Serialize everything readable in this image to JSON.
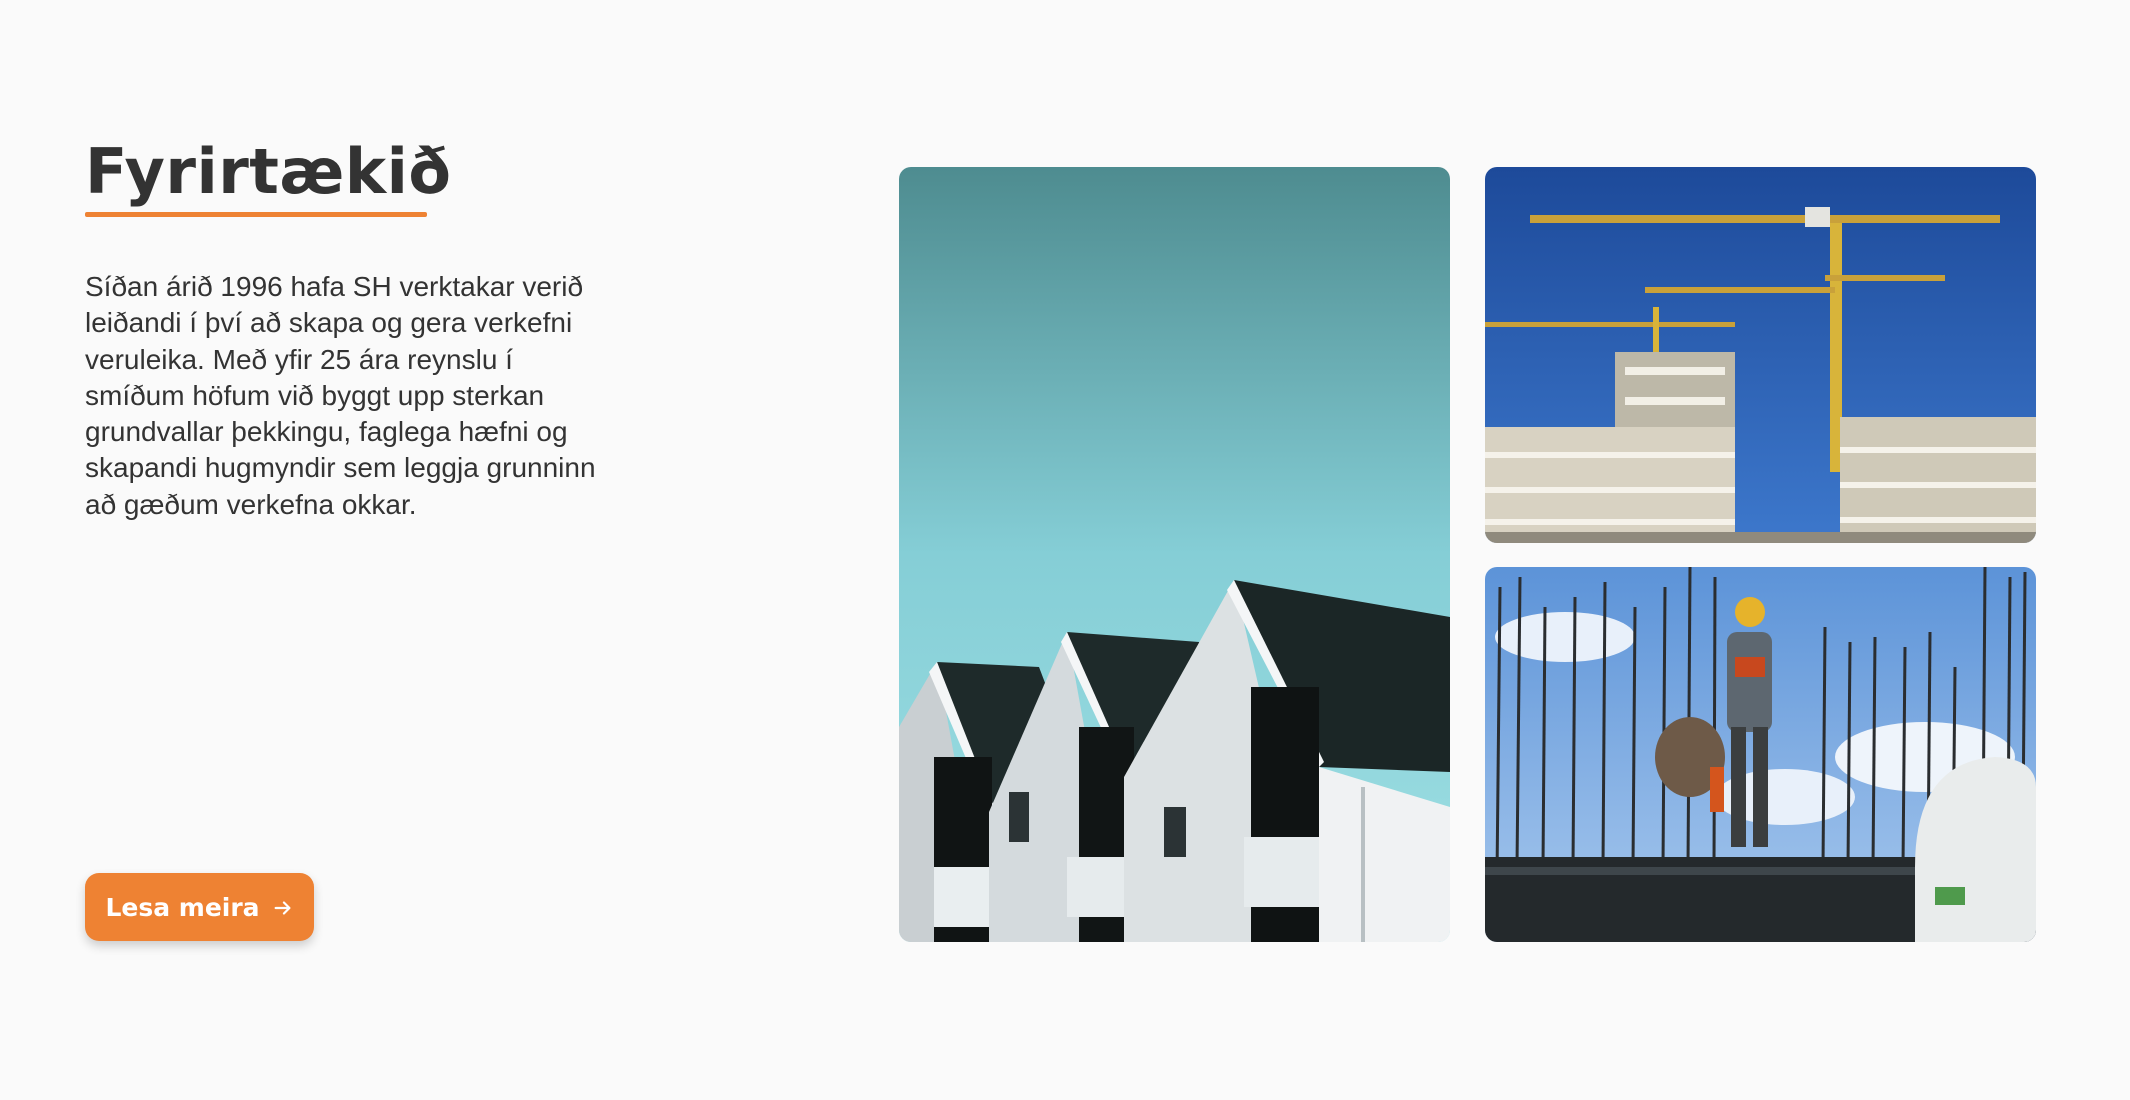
{
  "section": {
    "title": "Fyrirtækið",
    "description": "Síðan árið 1996 hafa SH verktakar verið leiðandi í því að skapa og gera verkefni veruleika. Með yfir 25 ára reynslu í smíðum höfum við byggt upp sterkan grundvallar þekkingu, faglega hæfni og skapandi hugmyndir sem leggja grunninn að gæðum verkefna okkar.",
    "cta_label": "Lesa meira",
    "cta_icon": "arrow-right-icon"
  },
  "colors": {
    "accent": "#ee8233",
    "text": "#333333",
    "background": "#fafafa"
  },
  "images": [
    {
      "name": "houses-photo",
      "subject": "gabled houses against teal sky"
    },
    {
      "name": "cranes-photo",
      "subject": "tower cranes over building under construction"
    },
    {
      "name": "workers-photo",
      "subject": "construction workers among rebar"
    }
  ]
}
